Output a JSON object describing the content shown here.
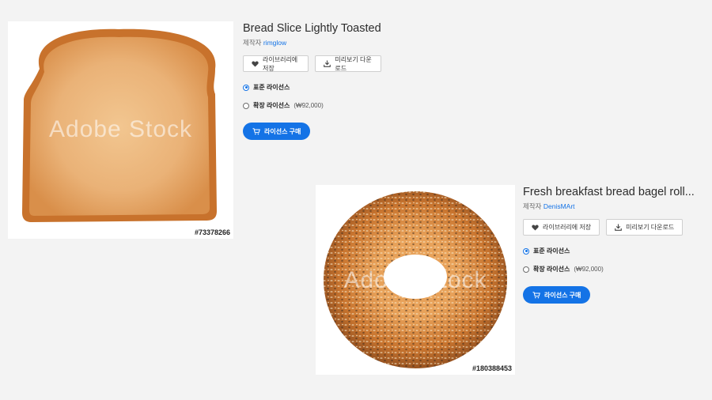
{
  "colors": {
    "accent": "#1473e6",
    "background": "#f3f3f3"
  },
  "cards": [
    {
      "title": "Bread Slice Lightly Toasted",
      "creator_label": "제작자",
      "creator_name": "rimglow",
      "asset_id": "#73378266",
      "watermark": "Adobe Stock",
      "save_label": "라이브러리에 저장",
      "preview_label": "미리보기 다운로드",
      "license_standard": "표준 라이선스",
      "license_extended": "확장 라이선스",
      "license_extended_price": "(₩92,000)",
      "selected_license": "standard",
      "buy_label": "라이선스 구매"
    },
    {
      "title": "Fresh breakfast bread bagel roll...",
      "creator_label": "제작자",
      "creator_name": "DenisMArt",
      "asset_id": "#180388453",
      "watermark": "Adobe Stock",
      "save_label": "라이브러리에 저장",
      "preview_label": "미리보기 다운로드",
      "license_standard": "표준 라이선스",
      "license_extended": "확장 라이선스",
      "license_extended_price": "(₩92,000)",
      "selected_license": "standard",
      "buy_label": "라이선스 구매"
    }
  ]
}
